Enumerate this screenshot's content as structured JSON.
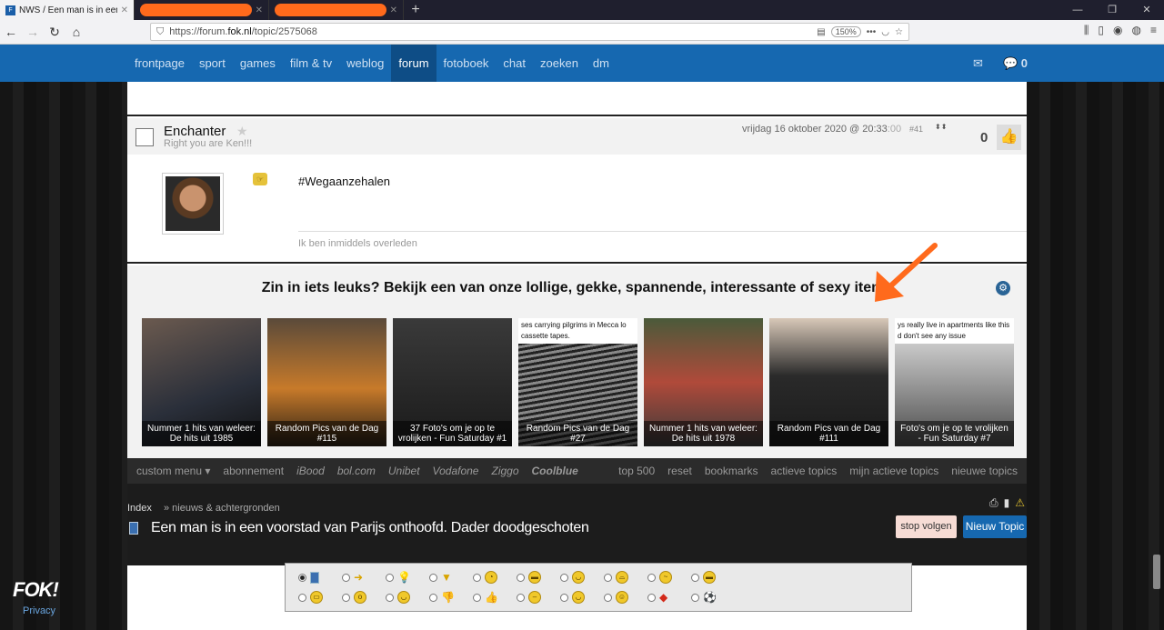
{
  "browser": {
    "tab_active": "NWS / Een man is in een voorst",
    "tab2": "",
    "tab3": "",
    "url_prefix": "https://forum.",
    "url_host": "fok.nl",
    "url_path": "/topic/2575068",
    "zoom": "150%"
  },
  "sitenav": {
    "items": [
      "frontpage",
      "sport",
      "games",
      "film & tv",
      "weblog",
      "forum",
      "fotoboek",
      "chat",
      "zoeken",
      "dm"
    ],
    "active": "forum",
    "msg_count": "0"
  },
  "post": {
    "username": "Enchanter",
    "user_title": "Right you are Ken!!!",
    "date": "vrijdag 16 oktober 2020 @ 20:33",
    "seconds": ":00",
    "number": "#41",
    "votes": "0",
    "text": "#Wegaanzehalen",
    "signature": "Ik ben inmiddels overleden"
  },
  "promo": {
    "title": "Zin in iets leuks? Bekijk een van onze lollige, gekke, spannende, interessante of sexy items",
    "cards": [
      {
        "caption": "Nummer 1 hits van weleer: De hits uit 1985",
        "top": ""
      },
      {
        "caption": "Random Pics van de Dag #115",
        "top": ""
      },
      {
        "caption": "37 Foto's om je op te vrolijken - Fun Saturday #1",
        "top": ""
      },
      {
        "caption": "Random Pics van de Dag #27",
        "top": "ses carrying pilgrims in Mecca lo cassette tapes."
      },
      {
        "caption": "Nummer 1 hits van weleer: De hits uit 1978",
        "top": ""
      },
      {
        "caption": "Random Pics van de Dag #111",
        "top": ""
      },
      {
        "caption": "Foto's om je op te vrolijken - Fun Saturday #7",
        "top": "ys really live in apartments like this d don't see any issue"
      }
    ]
  },
  "bottommenu": {
    "left": [
      "custom menu ▾",
      "abonnement",
      "iBood",
      "bol.com",
      "Unibet",
      "Vodafone",
      "Ziggo",
      "Coolblue"
    ],
    "right": [
      "top 500",
      "reset",
      "bookmarks",
      "actieve topics",
      "mijn actieve topics",
      "nieuwe topics"
    ]
  },
  "crumbs": {
    "index": "Index",
    "section": "» nieuws & achtergronden"
  },
  "topic": {
    "title": "Een man is in een voorstad van Parijs onthoofd. Dader doodgeschoten",
    "stop": "stop volgen",
    "new": "Nieuw Topic"
  },
  "footer": {
    "logo": "FOK!",
    "privacy": "Privacy"
  },
  "colors": {
    "brand_blue": "#1668b0",
    "annotation_orange": "#ff6a1c"
  }
}
